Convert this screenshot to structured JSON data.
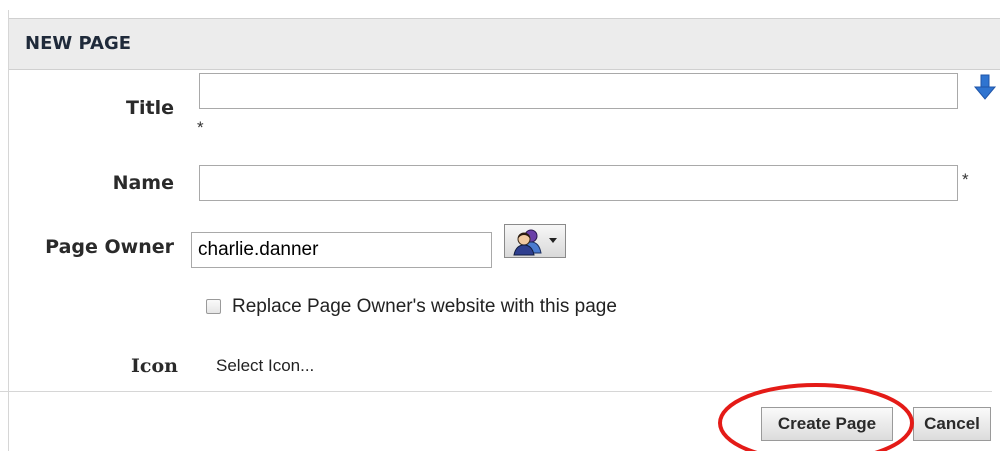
{
  "dialog": {
    "title": "NEW PAGE"
  },
  "form": {
    "title": {
      "label": "Title",
      "value": "",
      "required_marker": "*"
    },
    "name": {
      "label": "Name",
      "value": "",
      "required_marker": "*"
    },
    "page_owner": {
      "label": "Page Owner",
      "value": "charlie.danner"
    },
    "replace_website": {
      "label": "Replace Page Owner's website with this page",
      "checked": false
    },
    "icon": {
      "label": "Icon",
      "link_text": "Select Icon..."
    }
  },
  "buttons": {
    "create_label": "Create Page",
    "cancel_label": "Cancel"
  },
  "icons": {
    "title_arrow": "blue-down-arrow-icon",
    "owner_picker": "people-picker-icon",
    "dropdown": "dropdown-caret-icon"
  },
  "colors": {
    "header_bg": "#ececec",
    "annotation": "#e41b17",
    "arrow_blue": "#2f74d0"
  }
}
